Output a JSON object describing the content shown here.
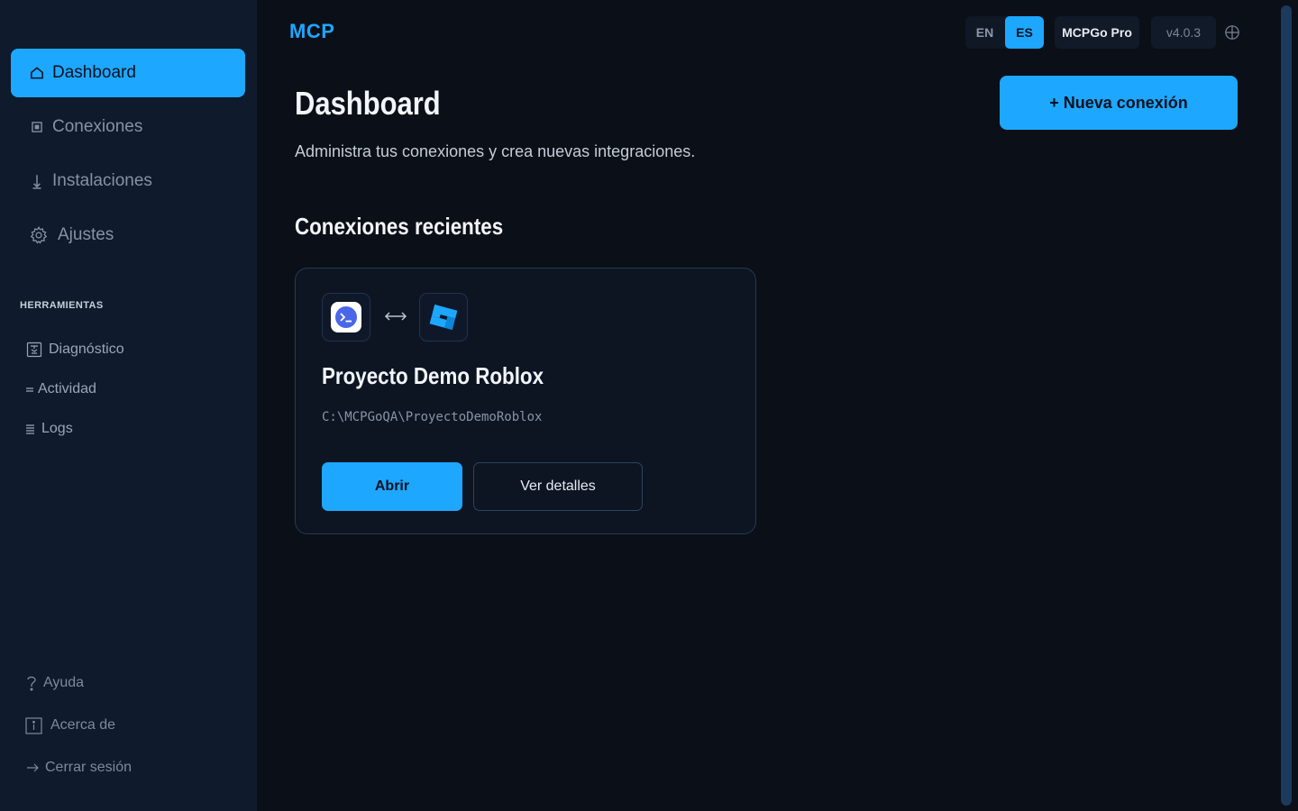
{
  "sidebar": {
    "nav": [
      {
        "label": "Dashboard",
        "icon": "home-icon",
        "active": true
      },
      {
        "label": "Conexiones",
        "icon": "connections-icon",
        "active": false
      },
      {
        "label": "Instalaciones",
        "icon": "download-icon",
        "active": false
      },
      {
        "label": "Ajustes",
        "icon": "gear-icon",
        "active": false
      }
    ],
    "tools_label": "HERRAMIENTAS",
    "tools": [
      {
        "label": "Diagnóstico",
        "icon": "diagnostic-icon"
      },
      {
        "label": "Actividad",
        "icon": "activity-icon"
      },
      {
        "label": "Logs",
        "icon": "logs-icon"
      }
    ],
    "footer": [
      {
        "label": "Ayuda",
        "icon": "help-icon"
      },
      {
        "label": "Acerca de",
        "icon": "info-icon"
      },
      {
        "label": "Cerrar sesión",
        "icon": "logout-icon"
      }
    ]
  },
  "header": {
    "brand": "MCP",
    "languages": [
      {
        "code": "EN",
        "active": false
      },
      {
        "code": "ES",
        "active": true
      }
    ],
    "plan": "MCPGo Pro",
    "version": "v4.0.3",
    "globe_icon": "globe-icon"
  },
  "main": {
    "title": "Dashboard",
    "subtitle": "Administra tus conexiones y crea nuevas integraciones.",
    "new_connection_label": "+ Nueva conexión",
    "recent_title": "Conexiones recientes",
    "recent": [
      {
        "name": "Proyecto Demo Roblox",
        "path": "C:\\MCPGoQA\\ProyectoDemoRoblox",
        "left_app_icon": "terminal-app-icon",
        "link_icon": "bidirectional-arrow-icon",
        "right_app_icon": "roblox-studio-icon",
        "open_label": "Abrir",
        "details_label": "Ver detalles"
      }
    ]
  },
  "colors": {
    "accent": "#1ea7ff",
    "background": "#0b0f17",
    "sidebar": "#0f1a2c",
    "card_border": "#243a52"
  }
}
